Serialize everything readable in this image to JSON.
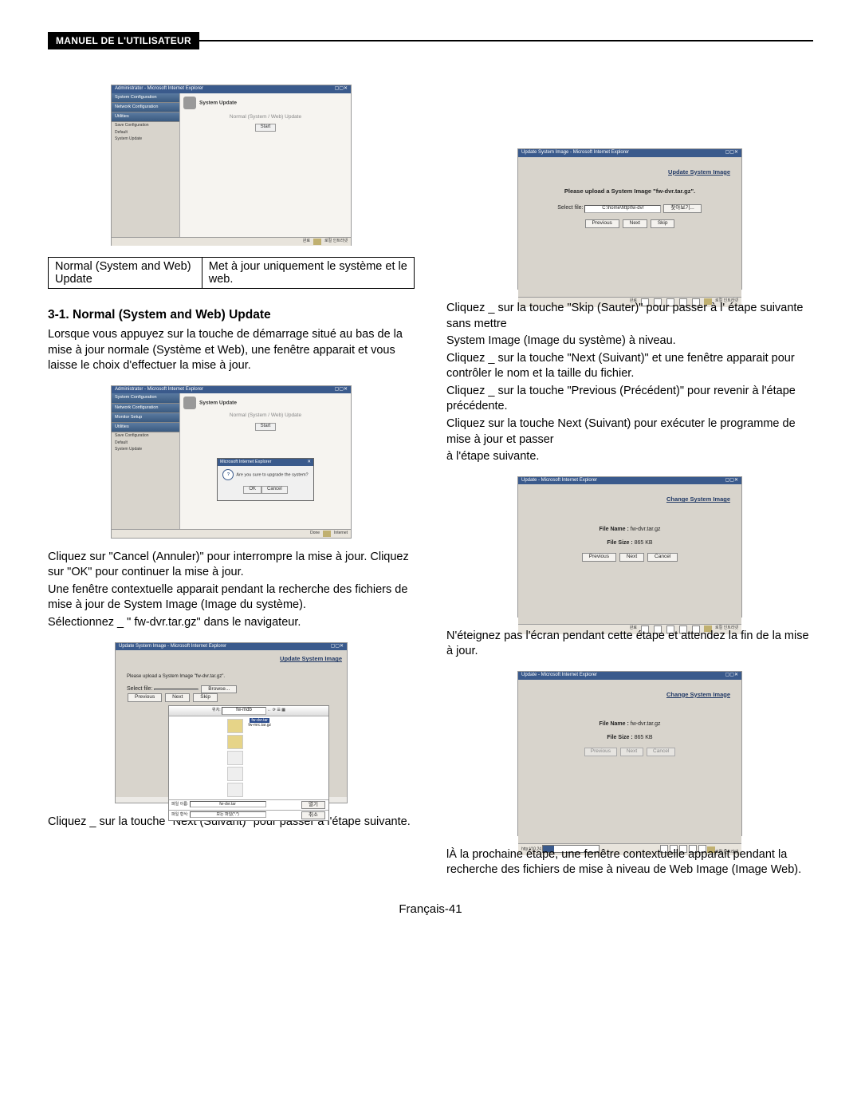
{
  "header": {
    "title": "MANUEL DE L'UTILISATEUR"
  },
  "footer": {
    "pagenum": "Français-41"
  },
  "table1": {
    "l1": "Normal (System and Web) Update",
    "r1": "Met à jour uniquement le système et le web."
  },
  "left": {
    "h31": "3-1. Normal (System and Web) Update",
    "p1": "Lorsque vous appuyez sur la touche de démarrage situé au bas de la mise à jour normale (Système et Web), une fenêtre apparait et vous laisse le choix d'effectuer la mise à jour.",
    "p2": "Cliquez sur \"Cancel (Annuler)\" pour interrompre la mise à jour. Cliquez sur \"OK\" pour continuer la mise à jour.",
    "p3": "Une fenêtre contextuelle apparait pendant la recherche des fichiers de mise à jour de System Image (Image du système).",
    "p4": "Sélectionnez _ \" fw-dvr.tar.gz\" dans le navigateur.",
    "p5": "Cliquez _ sur la touche \"Next (Suivant)\" pour passer à l'étape suivante."
  },
  "right": {
    "p1": "Cliquez _ sur la touche \"Skip (Sauter)\" pour passer à l' étape suivante sans mettre",
    "p2": "System Image (Image du système) à niveau.",
    "p3": "Cliquez _ sur la touche \"Next (Suivant)\" et une fenêtre apparait pour contrôler le nom et la taille du fichier.",
    "p4": "Cliquez _ sur la touche \"Previous (Précédent)\" pour revenir à l'étape précédente.",
    "p5": "Cliquez sur la touche Next (Suivant) pour exécuter le programme de mise à jour et passer",
    "p6": "à l'étape suivante.",
    "p7": "N'éteignez pas l'écran pendant cette étape et attendez la fin de la mise à jour.",
    "p8": "lÀ la prochaine étape, une fenêtre contextuelle apparait pendant la recherche des fichiers de mise à niveau de Web Image (Image Web)."
  },
  "ss": {
    "admin_title": "Administrator - Microsoft Internet Explorer",
    "system_update": "System Update",
    "normal_line": "Normal (System / Web) Update",
    "start": "Start",
    "side1": "System Configuration",
    "side2": "Network Configuration",
    "side3": "Monitor Setup",
    "side4": "Utilities",
    "sub1": "Save Configuration",
    "sub2": "Default",
    "sub3": "System Update",
    "popup_t": "Microsoft Internet Explorer",
    "popup_q": "Are you sure to upgrade the system?",
    "ok": "OK",
    "cancel": "Cancel",
    "status_text": "로컬 인트라넷",
    "upd_img_title": "Update System Image - Microsoft Internet Explorer",
    "upd_link": "Update System Image",
    "upd_txt": "Please upload a System Image \"fw-dvr.tar.gz\".",
    "select_file": "Select file:",
    "file_path": "C:\\home\\http\\fw-dvr",
    "browse_ko": "찾아보기...",
    "prev": "Previous",
    "next": "Next",
    "skip": "Skip",
    "chg_title": "Update - Microsoft Internet Explorer",
    "chg_link": "Change System Image",
    "fname_l": "File Name :",
    "fname": "fw-dvr.tar.gz",
    "fsize_l": "File Size :",
    "fsize": "865 KB",
    "url": "http://10.24",
    "done": "완료",
    "fb_folder": "fw-mdb",
    "fb_sel": "fw-dvr.tar",
    "fb_open": "열기",
    "fb_cancel": "취소",
    "fb_name_l": "파일 이름:",
    "fb_type_l": "파일 형식:",
    "fb_type_v": "모든 파일(*.*)"
  }
}
